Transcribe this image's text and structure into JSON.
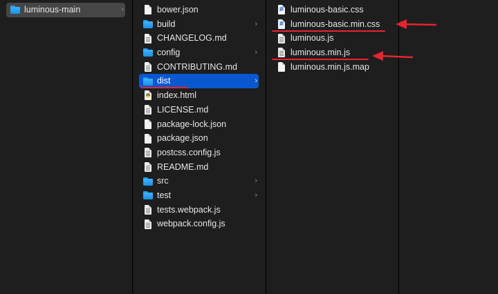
{
  "colors": {
    "background": "#1e1e1e",
    "selection_blue": "#0a58d0",
    "selection_gray": "#464646",
    "annotation_red": "#e3262f",
    "folder_blue": "#1f9bee"
  },
  "column1": {
    "items": [
      {
        "label": "luminous-main",
        "icon": "folder-icon",
        "has_children": true
      }
    ]
  },
  "column2": {
    "items": [
      {
        "label": "bower.json",
        "icon": "document-icon"
      },
      {
        "label": "build",
        "icon": "folder-icon",
        "has_children": true
      },
      {
        "label": "CHANGELOG.md",
        "icon": "document-icon"
      },
      {
        "label": "config",
        "icon": "folder-icon",
        "has_children": true
      },
      {
        "label": "CONTRIBUTING.md",
        "icon": "document-icon"
      },
      {
        "label": "dist",
        "icon": "folder-icon",
        "has_children": true,
        "selected": true
      },
      {
        "label": "index.html",
        "icon": "html-file-icon"
      },
      {
        "label": "LICENSE.md",
        "icon": "document-icon"
      },
      {
        "label": "package-lock.json",
        "icon": "document-icon"
      },
      {
        "label": "package.json",
        "icon": "document-icon"
      },
      {
        "label": "postcss.config.js",
        "icon": "js-file-icon"
      },
      {
        "label": "README.md",
        "icon": "document-icon"
      },
      {
        "label": "src",
        "icon": "folder-icon",
        "has_children": true
      },
      {
        "label": "test",
        "icon": "folder-icon",
        "has_children": true
      },
      {
        "label": "tests.webpack.js",
        "icon": "js-file-icon"
      },
      {
        "label": "webpack.config.js",
        "icon": "js-file-icon"
      }
    ]
  },
  "column3": {
    "items": [
      {
        "label": "luminous-basic.css",
        "icon": "css-file-icon"
      },
      {
        "label": "luminous-basic.min.css",
        "icon": "css-file-icon",
        "annotated": true
      },
      {
        "label": "luminous.js",
        "icon": "js-file-icon"
      },
      {
        "label": "luminous.min.js",
        "icon": "js-file-icon",
        "annotated": true
      },
      {
        "label": "luminous.min.js.map",
        "icon": "document-icon"
      }
    ]
  },
  "glyphs": {
    "chevron": "›",
    "css_mark": "#"
  }
}
